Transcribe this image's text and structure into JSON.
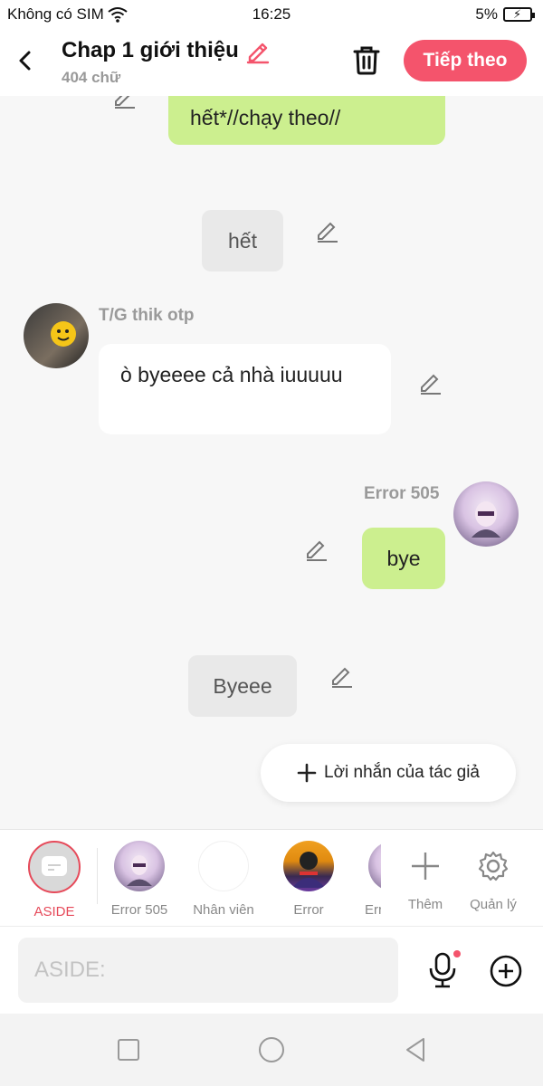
{
  "status_bar": {
    "carrier": "Không có SIM",
    "time": "16:25",
    "battery": "5%"
  },
  "header": {
    "title": "Chap 1 giới thiệu",
    "word_count": "404 chữ",
    "next_label": "Tiếp theo"
  },
  "messages": {
    "m1": {
      "text": "hết*//chạy theo//"
    },
    "m2": {
      "text": "hết"
    },
    "m3": {
      "name": "T/G thik otp",
      "text": "ò byeeee cả nhà iuuuuu"
    },
    "m4": {
      "name": "Error 505",
      "text": "bye"
    },
    "m5": {
      "text": "Byeee"
    }
  },
  "author_note_label": "Lời nhắn của tác giả",
  "characters": [
    {
      "label": "ASIDE"
    },
    {
      "label": "Error 505"
    },
    {
      "label": "Nhân viên"
    },
    {
      "label": "Error"
    },
    {
      "label": "Err"
    },
    {
      "label": "Thêm"
    },
    {
      "label": "Quản lý"
    }
  ],
  "input": {
    "placeholder": "ASIDE:"
  },
  "colors": {
    "accent": "#f4546c",
    "green_bubble": "#ccef8f",
    "active_char": "#e64a5a"
  }
}
